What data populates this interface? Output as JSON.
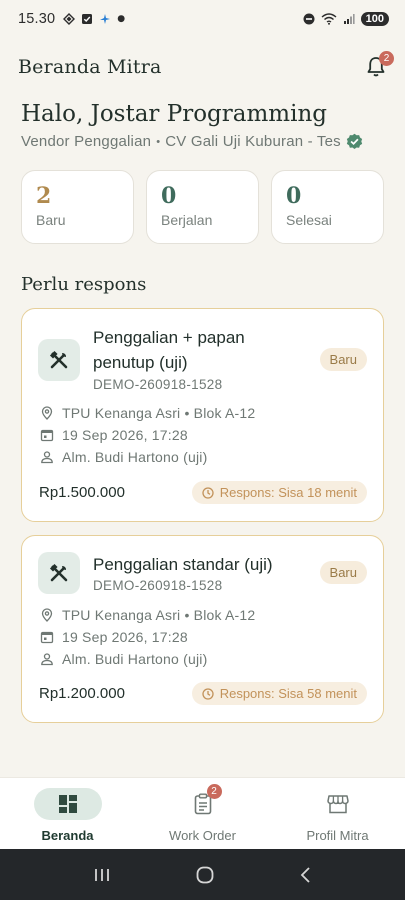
{
  "status_bar": {
    "time": "15.30",
    "battery": "100"
  },
  "app_bar": {
    "title": "Beranda Mitra",
    "notification_count": "2"
  },
  "greeting": {
    "title": "Halo, Jostar Programming",
    "role": "Vendor Penggalian",
    "separator": "•",
    "company": "CV Gali Uji Kuburan - Tes"
  },
  "stats": [
    {
      "value": "2",
      "label": "Baru",
      "color": "#b08a4e"
    },
    {
      "value": "0",
      "label": "Berjalan",
      "color": "#3f6b5c"
    },
    {
      "value": "0",
      "label": "Selesai",
      "color": "#3f6b5c"
    }
  ],
  "section": {
    "title": "Perlu respons"
  },
  "orders": [
    {
      "title": "Penggalian + papan penutup (uji)",
      "code": "DEMO-260918-1528",
      "status": "Baru",
      "location": "TPU Kenanga Asri • Blok A-12",
      "datetime": "19 Sep 2026, 17:28",
      "deceased": "Alm. Budi Hartono (uji)",
      "price": "Rp1.500.000",
      "response": "Respons: Sisa 18 menit"
    },
    {
      "title": "Penggalian standar (uji)",
      "code": "DEMO-260918-1528",
      "status": "Baru",
      "location": "TPU Kenanga Asri • Blok A-12",
      "datetime": "19 Sep 2026, 17:28",
      "deceased": "Alm. Budi Hartono (uji)",
      "price": "Rp1.200.000",
      "response": "Respons: Sisa 58 menit"
    }
  ],
  "bottom_nav": [
    {
      "label": "Beranda",
      "icon": "dashboard-icon",
      "active": true
    },
    {
      "label": "Work Order",
      "icon": "clipboard-icon",
      "badge": "2"
    },
    {
      "label": "Profil Mitra",
      "icon": "storefront-icon"
    }
  ],
  "colors": {
    "accent": "#3f6b5c",
    "gold": "#b08a4e",
    "badge": "#c96a5c",
    "card_border": "#e6cf9a"
  }
}
